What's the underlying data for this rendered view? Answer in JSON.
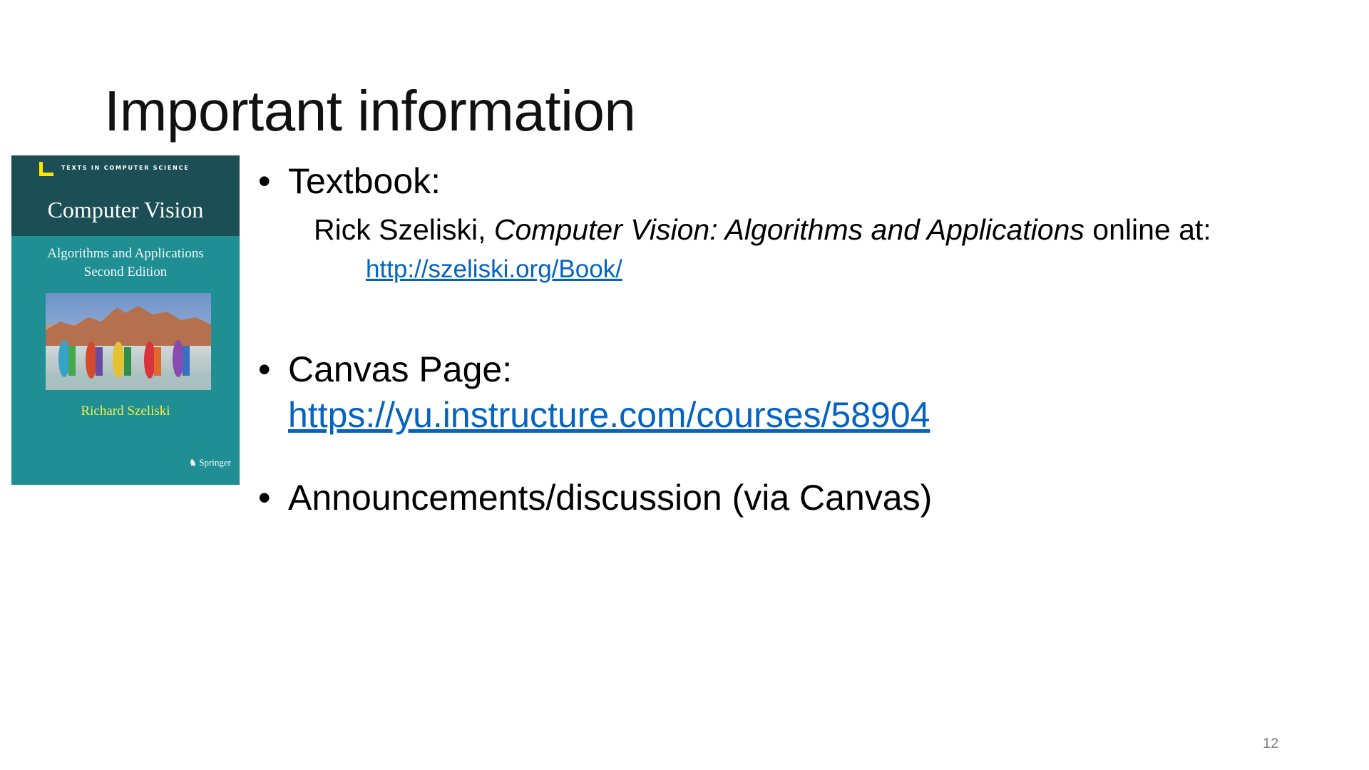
{
  "slide": {
    "title": "Important information",
    "page_number": "12"
  },
  "book_cover": {
    "series": "TEXTS IN COMPUTER SCIENCE",
    "title": "Computer Vision",
    "subtitle_line1": "Algorithms and Applications",
    "subtitle_line2": "Second Edition",
    "author": "Richard Szeliski",
    "publisher": "Springer",
    "colors": {
      "cover": "#1f8f94",
      "band": "#1c4f55",
      "accent": "#ffe500",
      "author": "#f4ee4a"
    }
  },
  "bullets": {
    "textbook_label": "Textbook:",
    "textbook_author": "Rick Szeliski, ",
    "textbook_title": "Computer Vision: Algorithms and Applications",
    "textbook_suffix": " online at:",
    "textbook_url": "http://szeliski.org/Book/",
    "canvas_label": "Canvas Page:",
    "canvas_url": "https://yu.instructure.com/courses/58904",
    "announcements": "Announcements/discussion (via Canvas)"
  },
  "colors": {
    "link": "#0563c1",
    "page_number": "#808080"
  }
}
